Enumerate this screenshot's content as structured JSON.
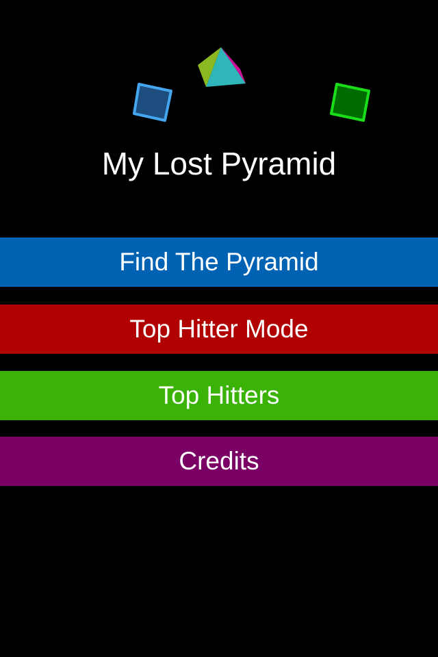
{
  "app": {
    "title": "My Lost Pyramid"
  },
  "menu": {
    "items": [
      {
        "label": "Find The Pyramid",
        "color": "#0062b3"
      },
      {
        "label": "Top Hitter Mode",
        "color": "#b10000"
      },
      {
        "label": "Top Hitters",
        "color": "#3ab206"
      },
      {
        "label": "Credits",
        "color": "#7a0066"
      }
    ]
  },
  "decorations": {
    "icons": [
      "pyramid-icon",
      "blue-cube-icon",
      "green-cube-icon"
    ],
    "colors": {
      "pyramid_left": "#8ab820",
      "pyramid_front": "#2fb6b8",
      "pyramid_right": "#d0109a",
      "blue_cube_fill": "#1c4d7e",
      "blue_cube_stroke": "#45a6f0",
      "green_cube_fill": "#006b00",
      "green_cube_stroke": "#1bde1b"
    }
  }
}
